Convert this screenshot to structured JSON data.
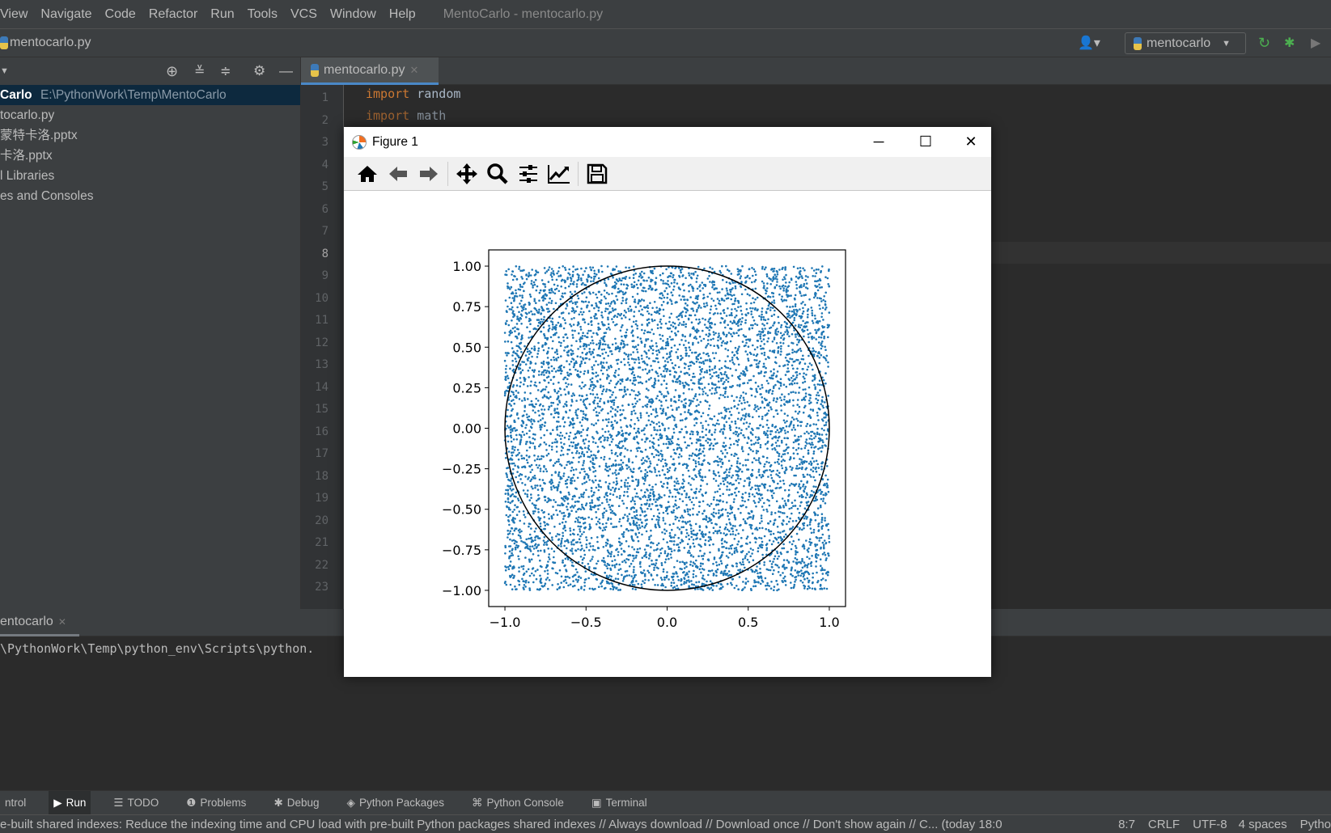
{
  "menu": {
    "items": [
      "View",
      "Navigate",
      "Code",
      "Refactor",
      "Run",
      "Tools",
      "VCS",
      "Window",
      "Help"
    ],
    "title": "MentoCarlo - mentocarlo.py"
  },
  "navbar": {
    "file": "mentocarlo.py",
    "run_config": "mentocarlo"
  },
  "project": {
    "root_name": "Carlo",
    "root_path": "E:\\PythonWork\\Temp\\MentoCarlo",
    "items": [
      "tocarlo.py",
      "蒙特卡洛.pptx",
      "卡洛.pptx",
      "l Libraries",
      "es and Consoles"
    ]
  },
  "editor": {
    "tab": "mentocarlo.py",
    "line_numbers": [
      "1",
      "2",
      "3",
      "4",
      "5",
      "6",
      "7",
      "8",
      "9",
      "10",
      "11",
      "12",
      "13",
      "14",
      "15",
      "16",
      "17",
      "18",
      "19",
      "20",
      "21",
      "22",
      "23"
    ],
    "current_line": "8",
    "code": [
      {
        "kw": "import",
        "rest": " random"
      },
      {
        "kw": "import",
        "rest": " math"
      }
    ]
  },
  "run": {
    "tab": "entocarlo",
    "console": "\\PythonWork\\Temp\\python_env\\Scripts\\python."
  },
  "tool_windows": [
    "ntrol",
    "Run",
    "TODO",
    "Problems",
    "Debug",
    "Python Packages",
    "Python Console",
    "Terminal"
  ],
  "status": {
    "message": "e-built shared indexes: Reduce the indexing time and CPU load with pre-built Python packages shared indexes // Always download // Download once // Don't show again // C... (today 18:0",
    "position": "8:7",
    "line_sep": "CRLF",
    "encoding": "UTF-8",
    "indent": "4 spaces",
    "interpreter": "Pytho"
  },
  "figure": {
    "title": "Figure 1",
    "toolbar": [
      "home-icon",
      "back-icon",
      "forward-icon",
      "pan-icon",
      "zoom-icon",
      "configure-subplots-icon",
      "edit-axis-icon",
      "save-icon"
    ]
  },
  "chart_data": {
    "type": "scatter",
    "distribution": "uniform random points in square [-1,1]x[-1,1]",
    "point_color": "#1f77b4",
    "overlay": {
      "shape": "circle",
      "center": [
        0,
        0
      ],
      "radius": 1,
      "color": "#000000"
    },
    "xlim": [
      -1.1,
      1.1
    ],
    "ylim": [
      -1.1,
      1.1
    ],
    "xticks": [
      "−1.0",
      "−0.5",
      "0.0",
      "0.5",
      "1.0"
    ],
    "xtick_values": [
      -1,
      -0.5,
      0,
      0.5,
      1
    ],
    "yticks": [
      "1.00",
      "0.75",
      "0.50",
      "0.25",
      "0.00",
      "−0.25",
      "−0.50",
      "−0.75",
      "−1.00"
    ],
    "ytick_values": [
      1,
      0.75,
      0.5,
      0.25,
      0,
      -0.25,
      -0.5,
      -0.75,
      -1
    ],
    "grid": false,
    "legend": "none"
  }
}
